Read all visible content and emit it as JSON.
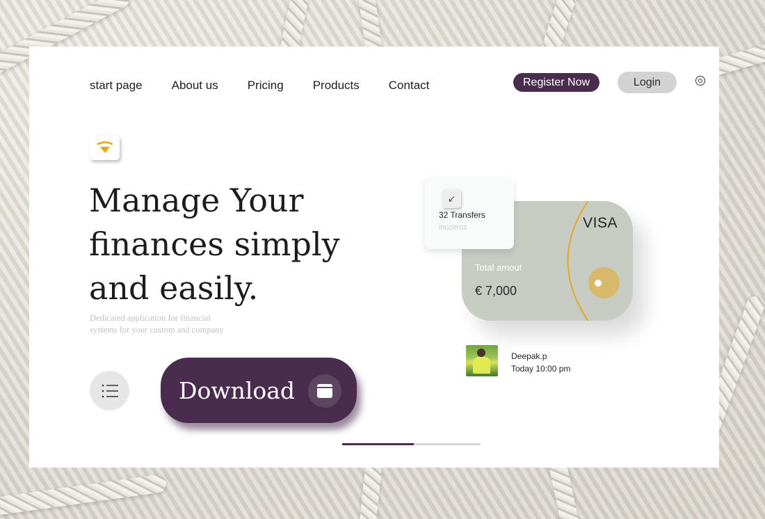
{
  "nav": {
    "items": [
      {
        "label": "start page"
      },
      {
        "label": "About us"
      },
      {
        "label": "Pricing"
      },
      {
        "label": "Products"
      },
      {
        "label": "Contact"
      }
    ],
    "register_label": "Register Now",
    "login_label": "Login",
    "settings_icon": "settings-circle-icon"
  },
  "brand": {
    "logo_icon": "wifi-signal-icon",
    "accent": "#f0a500"
  },
  "hero": {
    "headline_line1": "Manage Your",
    "headline_line2": "finances simply",
    "headline_line3": "and easily.",
    "subtext_line1": "Dedicated application for financial",
    "subtext_line2": "systems for your custom and company",
    "download_label": "Download",
    "menu_icon": "list-icon",
    "download_icon": "window-icon"
  },
  "slider": {
    "progress": 0.52
  },
  "card": {
    "brand": "VISA",
    "total_label": "Total amout",
    "total_value": "€ 7,000",
    "color": "#c7ccc3",
    "chip_color": "#d8b86a"
  },
  "transfers": {
    "title": "32 Transfers",
    "subtitle": "inccercs",
    "icon": "arrow-down-left-icon"
  },
  "activity": {
    "name": "Deepak.p",
    "time": "Today 10:00 pm"
  },
  "colors": {
    "primary": "#4a2d4e",
    "login_bg": "#d3d3d3"
  }
}
